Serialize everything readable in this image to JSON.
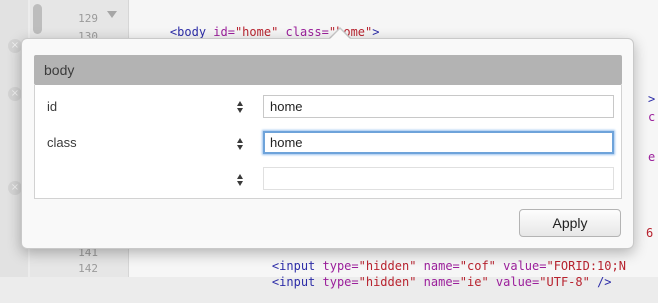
{
  "editor": {
    "line_numbers": {
      "top": "129",
      "partial": "130",
      "bottom1": "141",
      "bottom2": "142"
    },
    "line_top": {
      "open": "<",
      "tag": "body",
      "attr1": " id=",
      "val1": "\"home\"",
      "attr2": " class=",
      "val2": "\"home\"",
      "close": ">"
    },
    "line_141": {
      "open": "<",
      "tag": "input",
      "attr1": " type=",
      "val1": "\"hidden\"",
      "attr2": " name=",
      "val2": "\"cof\"",
      "attr3": " value=",
      "val3": "\"FORID:10;N"
    },
    "line_142": {
      "open": "<",
      "tag": "input",
      "attr1": " type=",
      "val1": "\"hidden\"",
      "attr2": " name=",
      "val2": "\"ie\"",
      "attr3": " value=",
      "val3": "\"UTF-8\"",
      "close": " />"
    },
    "right_peek": {
      "a": ">",
      "b": "c",
      "c": "e",
      "d": "6"
    },
    "close_glyph": "×"
  },
  "popover": {
    "title": "body",
    "attributes": [
      {
        "name": "id",
        "value": "home"
      },
      {
        "name": "class",
        "value": "home"
      },
      {
        "name": "",
        "value": ""
      }
    ],
    "apply_label": "Apply"
  },
  "colors": {
    "tag": "#2d2da8",
    "attribute": "#9b1f9b",
    "value": "#b8232f",
    "focus_ring": "#6ea3da",
    "header_bg": "#b3b3b3"
  },
  "icons": {
    "fold": "fold-triangle-icon",
    "stepper": "stepper-arrows-icon",
    "close": "close-icon"
  }
}
